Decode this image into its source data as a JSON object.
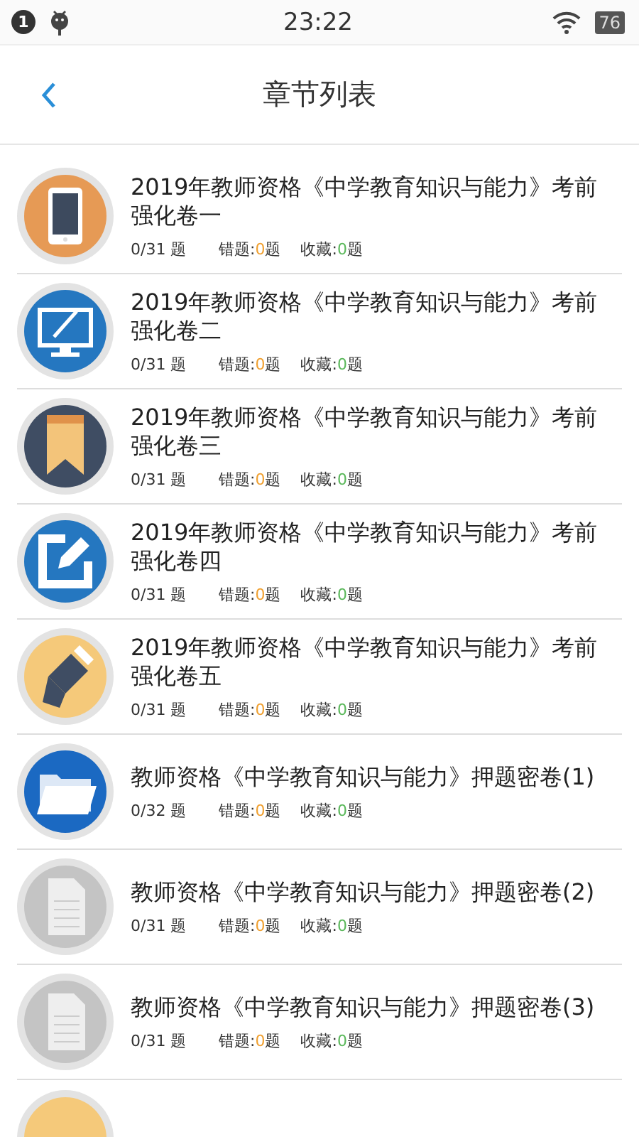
{
  "status_bar": {
    "notification_count": "1",
    "time": "23:22",
    "battery": "76"
  },
  "header": {
    "title": "章节列表"
  },
  "chapters": [
    {
      "kind": "phone",
      "title": "2019年教师资格《中学教育知识与能力》考前强化卷一",
      "progress": "0/31 题",
      "wrong_label": "错题:",
      "wrong_count": "0",
      "wrong_unit": "题",
      "fav_label": "收藏:",
      "fav_count": "0",
      "fav_unit": "题"
    },
    {
      "kind": "monitor",
      "title": "2019年教师资格《中学教育知识与能力》考前强化卷二",
      "progress": "0/31 题",
      "wrong_label": "错题:",
      "wrong_count": "0",
      "wrong_unit": "题",
      "fav_label": "收藏:",
      "fav_count": "0",
      "fav_unit": "题"
    },
    {
      "kind": "bookmark",
      "title": "2019年教师资格《中学教育知识与能力》考前强化卷三",
      "progress": "0/31 题",
      "wrong_label": "错题:",
      "wrong_count": "0",
      "wrong_unit": "题",
      "fav_label": "收藏:",
      "fav_count": "0",
      "fav_unit": "题"
    },
    {
      "kind": "edit",
      "title": "2019年教师资格《中学教育知识与能力》考前强化卷四",
      "progress": "0/31 题",
      "wrong_label": "错题:",
      "wrong_count": "0",
      "wrong_unit": "题",
      "fav_label": "收藏:",
      "fav_count": "0",
      "fav_unit": "题"
    },
    {
      "kind": "eraser",
      "title": "2019年教师资格《中学教育知识与能力》考前强化卷五",
      "progress": "0/31 题",
      "wrong_label": "错题:",
      "wrong_count": "0",
      "wrong_unit": "题",
      "fav_label": "收藏:",
      "fav_count": "0",
      "fav_unit": "题"
    },
    {
      "kind": "folder",
      "title": "教师资格《中学教育知识与能力》押题密卷(1)",
      "progress": "0/32 题",
      "wrong_label": "错题:",
      "wrong_count": "0",
      "wrong_unit": "题",
      "fav_label": "收藏:",
      "fav_count": "0",
      "fav_unit": "题"
    },
    {
      "kind": "document",
      "title": "教师资格《中学教育知识与能力》押题密卷(2)",
      "progress": "0/31 题",
      "wrong_label": "错题:",
      "wrong_count": "0",
      "wrong_unit": "题",
      "fav_label": "收藏:",
      "fav_count": "0",
      "fav_unit": "题"
    },
    {
      "kind": "document",
      "title": "教师资格《中学教育知识与能力》押题密卷(3)",
      "progress": "0/31 题",
      "wrong_label": "错题:",
      "wrong_count": "0",
      "wrong_unit": "题",
      "fav_label": "收藏:",
      "fav_count": "0",
      "fav_unit": "题"
    },
    {
      "kind": "partial"
    }
  ]
}
